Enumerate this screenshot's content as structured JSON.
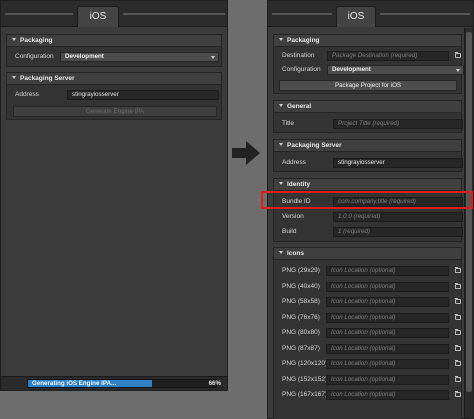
{
  "left_panel": {
    "tab": "iOS",
    "packaging": {
      "title": "Packaging",
      "configuration_label": "Configuration",
      "configuration_value": "Development"
    },
    "packaging_server": {
      "title": "Packaging Server",
      "address_label": "Address",
      "address_value": "stingrayiosserver",
      "button_label": "Generate Engine IPA"
    },
    "status": {
      "text": "Generating iOS Engine IPA...",
      "percent_label": "66%",
      "progress": 0.66
    }
  },
  "right_panel": {
    "tab": "iOS",
    "packaging": {
      "title": "Packaging",
      "destination_label": "Destination",
      "destination_placeholder": "Package Destination (required)",
      "configuration_label": "Configuration",
      "configuration_value": "Development",
      "button_label": "Package Project for iOS"
    },
    "general": {
      "title": "General",
      "title_label": "Title",
      "title_placeholder": "Project Title (required)"
    },
    "packaging_server": {
      "title": "Packaging Server",
      "address_label": "Address",
      "address_value": "stingrayiosserver"
    },
    "identity": {
      "title": "Identity",
      "bundle_id_label": "Bundle ID",
      "bundle_id_placeholder": "com.company.title (required)",
      "version_label": "Version",
      "version_placeholder": "1.0.0 (required)",
      "build_label": "Build",
      "build_placeholder": "1 (required)"
    },
    "icons": {
      "title": "Icons",
      "placeholder": "Icon Location (optional)",
      "items": [
        {
          "label": "PNG (29x29)"
        },
        {
          "label": "PNG (40x40)"
        },
        {
          "label": "PNG (58x58)"
        },
        {
          "label": "PNG (76x76)"
        },
        {
          "label": "PNG (80x80)"
        },
        {
          "label": "PNG (87x87)"
        },
        {
          "label": "PNG (120x120)"
        },
        {
          "label": "PNG (152x152)"
        },
        {
          "label": "PNG (167x167)"
        }
      ]
    }
  },
  "icons": {
    "arrow": "right-arrow-icon",
    "folder": "folder-icon",
    "caret": "chevron-down-icon"
  },
  "colors": {
    "highlight": "#e01b1b",
    "progress": "#2e82c4"
  }
}
